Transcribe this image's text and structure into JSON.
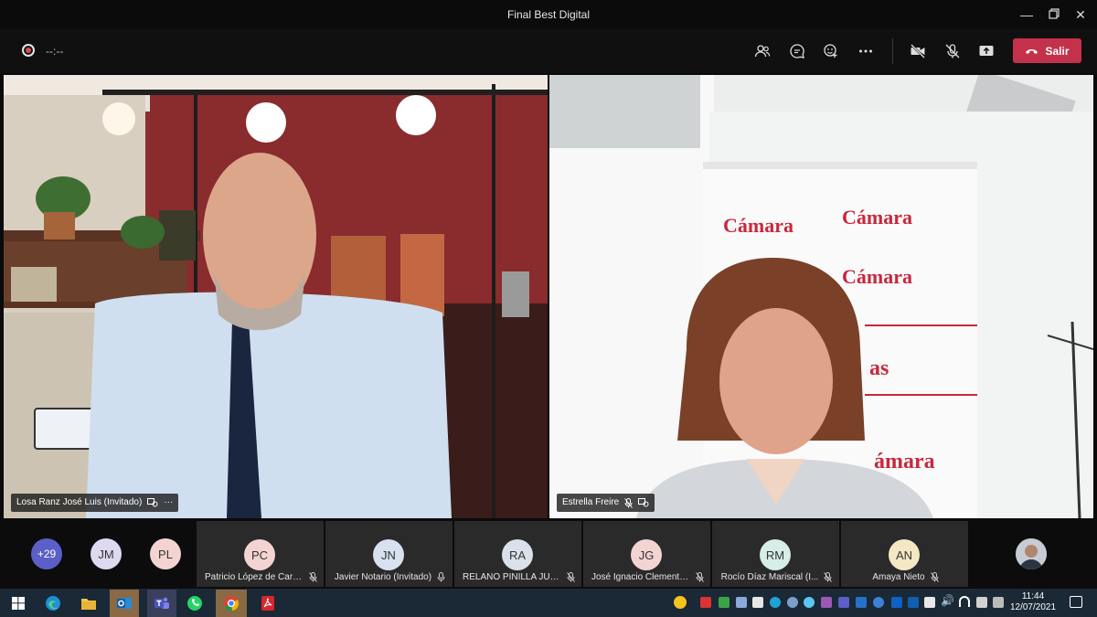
{
  "window": {
    "title": "Final Best Digital"
  },
  "toolbar": {
    "timer": "--:--",
    "leave_label": "Salir",
    "accent": "#c4314b"
  },
  "tiles": [
    {
      "name": "Losa Ranz José Luis (Invitado)",
      "more": "···"
    },
    {
      "name": "Estrella Freire"
    }
  ],
  "right_video_text": {
    "brand1": "Cámara",
    "brand2": "Cámara",
    "brand3": "Cámara",
    "brand4": "ámara",
    "fragment": "as"
  },
  "participants": {
    "overflow": "+29",
    "standalone": [
      {
        "initials": "JM"
      },
      {
        "initials": "PL"
      }
    ],
    "cards": [
      {
        "initials": "PC",
        "name": "Patricio López de Carri...",
        "color": "#f3d4d2"
      },
      {
        "initials": "JN",
        "name": "Javier Notario (Invitado)",
        "color": "#d7e1ef"
      },
      {
        "initials": "RA",
        "name": "RELANO PINILLA JUA...",
        "color": "#dbe1ea"
      },
      {
        "initials": "JG",
        "name": "José Ignacio Clemente...",
        "color": "#f3d4d2"
      },
      {
        "initials": "RM",
        "name": "Rocío Díaz Mariscal (I...",
        "color": "#d7ede7"
      },
      {
        "initials": "AN",
        "name": "Amaya Nieto",
        "color": "#f4e7c4"
      }
    ]
  },
  "clock": {
    "time": "11:44",
    "date": "12/07/2021"
  }
}
